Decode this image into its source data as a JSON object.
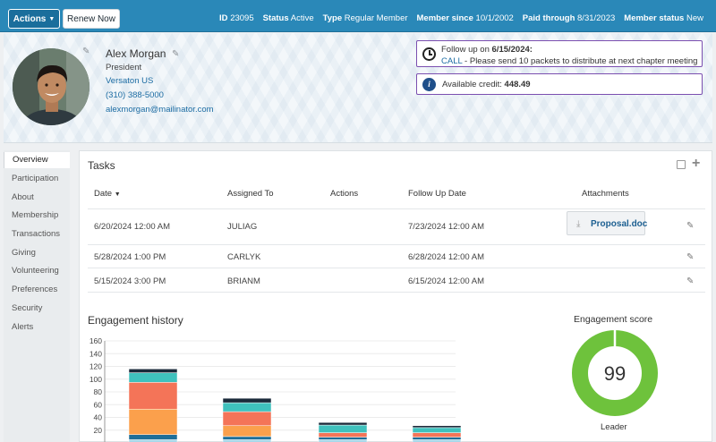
{
  "topbar": {
    "actions_label": "Actions",
    "renew_label": "Renew Now",
    "meta": [
      {
        "key": "ID",
        "value": "23095"
      },
      {
        "key": "Status",
        "value": "Active"
      },
      {
        "key": "Type",
        "value": "Regular Member"
      },
      {
        "key": "Member since",
        "value": "10/1/2002"
      },
      {
        "key": "Paid through",
        "value": "8/31/2023"
      },
      {
        "key": "Member status",
        "value": "New"
      }
    ]
  },
  "profile": {
    "name": "Alex Morgan",
    "title": "President",
    "organization": "Versaton US",
    "phone": "(310) 388-5000",
    "email": "alexmorgan@mailinator.com"
  },
  "alerts": {
    "followup_prefix": "Follow up on ",
    "followup_date": "6/15/2024:",
    "call_label": "CALL",
    "followup_note": " - Please send 10 packets to distribute at next chapter meeting",
    "credit_label": "Available credit: ",
    "credit_value": "448.49"
  },
  "sidebar": {
    "items": [
      "Overview",
      "Participation",
      "About",
      "Membership",
      "Transactions",
      "Giving",
      "Volunteering",
      "Preferences",
      "Security",
      "Alerts"
    ]
  },
  "tasks": {
    "title": "Tasks",
    "columns": [
      "Date",
      "Assigned To",
      "Actions",
      "Follow Up Date",
      "Attachments"
    ],
    "rows": [
      {
        "date": "6/20/2024 12:00 AM",
        "assigned": "JULIAG",
        "followup": "7/23/2024 12:00 AM",
        "attachment": "Proposal.doc"
      },
      {
        "date": "5/28/2024 1:00 PM",
        "assigned": "CARLYK",
        "followup": "6/28/2024 12:00 AM",
        "attachment": ""
      },
      {
        "date": "5/15/2024 3:00 PM",
        "assigned": "BRIANM",
        "followup": "6/15/2024 12:00 AM",
        "attachment": ""
      }
    ]
  },
  "engagement": {
    "history_title": "Engagement history",
    "score_title": "Engagement score",
    "score": "99",
    "score_level": "Leader"
  },
  "colors": {
    "topbar": "#2a88b8",
    "donut": "#6ec23c",
    "stack": [
      "#a8d8ea",
      "#1e6e99",
      "#fba04c",
      "#f47458",
      "#3fc1bd",
      "#1a2a3a"
    ]
  },
  "chart_data": {
    "type": "bar",
    "stacked": true,
    "ylim": [
      0,
      160
    ],
    "yticks": [
      20,
      40,
      60,
      80,
      100,
      120,
      140,
      160
    ],
    "categories": [
      "",
      "",
      "",
      ""
    ],
    "series": [
      {
        "values": [
          5,
          5,
          5,
          5
        ]
      },
      {
        "values": [
          8,
          5,
          4,
          4
        ]
      },
      {
        "values": [
          40,
          17,
          0,
          0
        ]
      },
      {
        "values": [
          42,
          22,
          7,
          7
        ]
      },
      {
        "values": [
          15,
          14,
          12,
          8
        ]
      },
      {
        "values": [
          6,
          7,
          4,
          3
        ]
      }
    ]
  }
}
